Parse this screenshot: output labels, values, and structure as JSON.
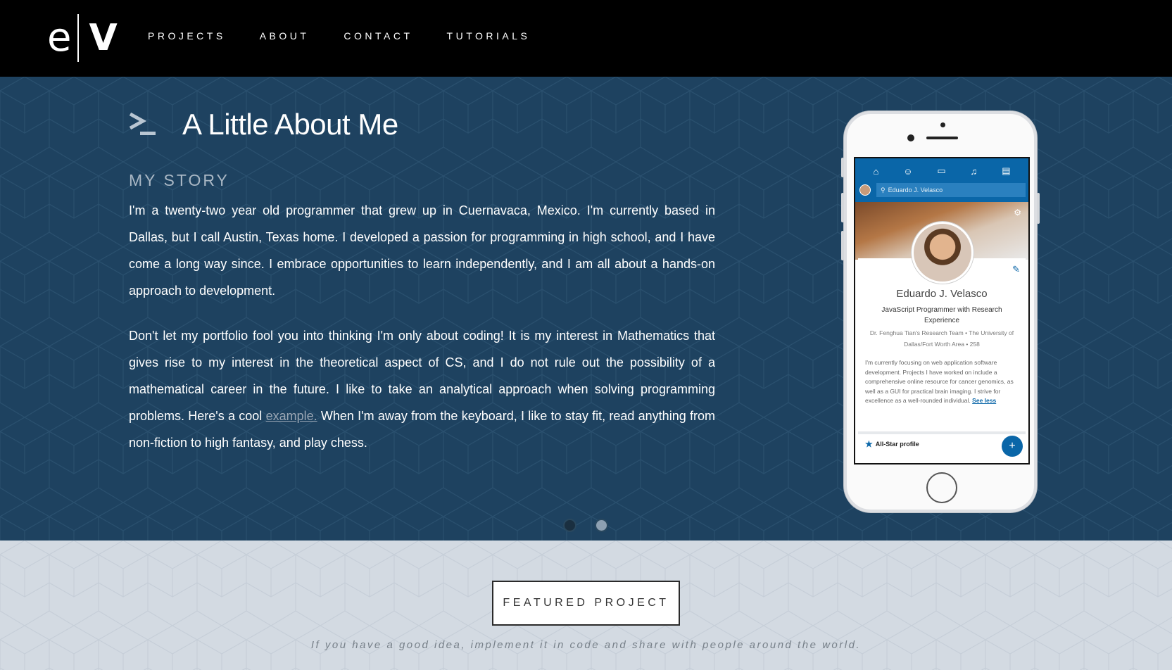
{
  "nav": {
    "logo_left": "e",
    "logo_right": "V",
    "items": [
      {
        "label": "PROJECTS"
      },
      {
        "label": "ABOUT"
      },
      {
        "label": "CONTACT"
      },
      {
        "label": "TUTORIALS"
      }
    ]
  },
  "about": {
    "icon": "terminal-prompt-icon",
    "title": "A Little About Me",
    "story_heading": "MY STORY",
    "paragraph1": "I'm a twenty-two year old programmer that grew up in Cuernavaca, Mexico. I'm currently based in Dallas, but I call Austin, Texas home. I developed a passion for programming in high school, and I have come a long way since. I embrace opportunities to learn independently, and I am all about a hands-on approach to development.",
    "paragraph2_before_link": "Don't let my portfolio fool you into thinking I'm only about coding! It is my interest in Mathematics that gives rise to my interest in the theoretical aspect of CS, and I do not rule out the possibility of a mathematical career in the future. I like to take an analytical approach when solving programming problems. Here's a cool ",
    "paragraph2_link": "example.",
    "paragraph2_after_link": " When I'm away from the keyboard, I like to stay fit, read anything from non-fiction to high fantasy, and play chess.",
    "carousel": {
      "count": 2,
      "active_index": 0
    }
  },
  "phone_profile": {
    "search_text": "Eduardo J. Velasco",
    "name": "Eduardo J. Velasco",
    "role": "JavaScript Programmer with Research Experience",
    "meta": "Dr. Fenghua Tian's Research Team • The University of Dallas/Fort Worth Area • 258",
    "description": "I'm currently focusing on web application software development. Projects I have worked on include a comprehensive online resource for cancer genomics, as well as a GUI for practical brain imaging. I strive for excellence as a well-rounded individual.",
    "see_less": "See less",
    "all_star": "All-Star profile",
    "fab": "+"
  },
  "featured": {
    "button_label": "FEATURED PROJECT",
    "quote": "If you have a good idea, implement it in code and share with people around the world."
  },
  "colors": {
    "nav_bg": "#000000",
    "hero_bg": "#1e4260",
    "featured_bg": "#d3dae2",
    "linkedin_blue": "#0a66a8"
  }
}
